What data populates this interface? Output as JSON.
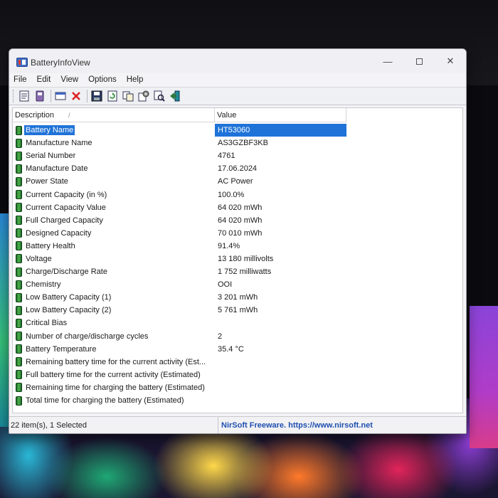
{
  "window": {
    "title": "BatteryInfoView",
    "minimize_glyph": "—",
    "close_glyph": "✕"
  },
  "menu": [
    "File",
    "Edit",
    "View",
    "Options",
    "Help"
  ],
  "toolbar_icons": [
    "properties-icon",
    "copy-icon",
    "report-icon",
    "delete-icon",
    "save-icon",
    "refresh-icon",
    "copy-items-icon",
    "options-icon",
    "find-icon",
    "exit-icon"
  ],
  "columns": {
    "description": "Description",
    "value": "Value",
    "sort_glyph": "/"
  },
  "rows": [
    {
      "label": "Battery Name",
      "value": "HT53060",
      "selected": true
    },
    {
      "label": "Manufacture Name",
      "value": "AS3GZBF3KB"
    },
    {
      "label": "Serial Number",
      "value": "4761"
    },
    {
      "label": "Manufacture Date",
      "value": "17.06.2024"
    },
    {
      "label": "Power State",
      "value": "AC Power"
    },
    {
      "label": "Current Capacity (in %)",
      "value": "100.0%"
    },
    {
      "label": "Current Capacity Value",
      "value": "64 020 mWh"
    },
    {
      "label": "Full Charged Capacity",
      "value": "64 020 mWh"
    },
    {
      "label": "Designed Capacity",
      "value": "70 010 mWh"
    },
    {
      "label": "Battery Health",
      "value": "91.4%"
    },
    {
      "label": "Voltage",
      "value": "13 180 millivolts"
    },
    {
      "label": "Charge/Discharge Rate",
      "value": "1 752 milliwatts"
    },
    {
      "label": "Chemistry",
      "value": "OOI"
    },
    {
      "label": "Low Battery Capacity (1)",
      "value": "3 201 mWh"
    },
    {
      "label": "Low Battery Capacity (2)",
      "value": "5 761 mWh"
    },
    {
      "label": "Critical Bias",
      "value": ""
    },
    {
      "label": "Number of charge/discharge cycles",
      "value": "2"
    },
    {
      "label": "Battery Temperature",
      "value": "35.4 °C"
    },
    {
      "label": "Remaining battery time for the current activity (Est...",
      "value": ""
    },
    {
      "label": "Full battery time for the current activity (Estimated)",
      "value": ""
    },
    {
      "label": "Remaining time for charging the battery (Estimated)",
      "value": ""
    },
    {
      "label": "Total  time for charging the battery (Estimated)",
      "value": ""
    }
  ],
  "status": {
    "count": "22 item(s), 1 Selected",
    "link": "NirSoft Freeware. https://www.nirsoft.net"
  },
  "colors": {
    "selection": "#1f73d8",
    "link": "#1f4fb0",
    "battery_green": "#4fb34a"
  }
}
